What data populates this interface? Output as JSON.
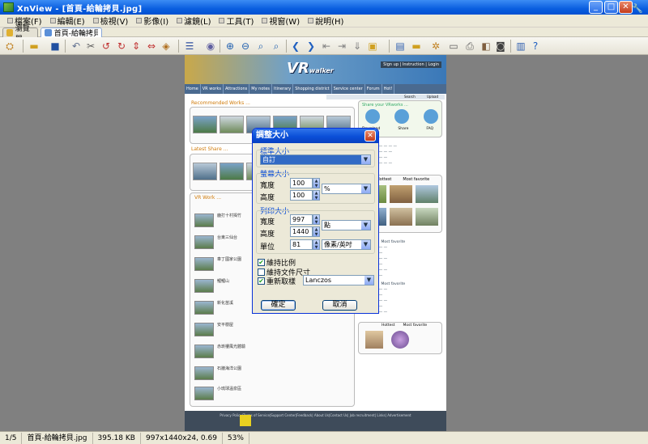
{
  "window": {
    "title": "XnView - [首頁-給輪拷貝.jpg]"
  },
  "menu": [
    "檔案(F)",
    "編輯(E)",
    "檢視(V)",
    "影像(I)",
    "濾鏡(L)",
    "工具(T)",
    "視窗(W)",
    "說明(H)"
  ],
  "tabs": [
    {
      "label": "瀏覽器"
    },
    {
      "label": "首頁-給輪拷貝.jpg"
    }
  ],
  "webpage": {
    "brand": "VR",
    "brand_suffix": "walker",
    "header_links": "Sign up | Instruction | Login",
    "nav": [
      "Home",
      "VR works",
      "Attractions",
      "My notes",
      "Itinerary",
      "Shopping district",
      "Service center",
      "Forum",
      "Hot!"
    ],
    "search_label": "Search",
    "upload_label": "Upload",
    "recommended_title": "Recommended Works ...",
    "latest_title": "Latest Share ...",
    "vr_work_title": "VR Work ...",
    "share_title": "Share your VRworks ...",
    "share_items": [
      "Download",
      "Share",
      "FAQ"
    ],
    "hottest": "Hottest",
    "most_favorite": "Most favorite",
    "vr_items": [
      "鹿打十村揭竹",
      "台東三仙台",
      "車丁國家公園",
      "鯉鯉山",
      "新化苗溪",
      "安平樹屋",
      "赤崁樓風光體驗",
      "石牆海洋公園",
      "小琉球溫泉區"
    ],
    "footer": "Privacy Policy|Terms of Service|Support Center|Feedback| About Us|Contact Us| Job recruitment| Links| Advertisement"
  },
  "dialog": {
    "title": "調整大小",
    "standard_label": "標準大小",
    "standard_value": "自訂",
    "screen_label": "螢幕大小",
    "width_label": "寬度",
    "height_label": "高度",
    "screen_width": "100",
    "screen_height": "100",
    "screen_unit": "%",
    "print_label": "列印大小",
    "print_width": "997",
    "print_height": "1440",
    "print_unit": "點",
    "unit_label": "單位",
    "resolution": "81",
    "resolution_unit": "像素/英吋",
    "keep_ratio": "維持比例",
    "keep_size": "維持文件尺寸",
    "resample": "重新取樣",
    "resample_method": "Lanczos",
    "ok": "確定",
    "cancel": "取消"
  },
  "status": {
    "index": "1/5",
    "filename": "首頁-給輪拷貝.jpg",
    "filesize": "395.18 KB",
    "dims": "997x1440x24, 0.69",
    "zoom": "53%"
  }
}
